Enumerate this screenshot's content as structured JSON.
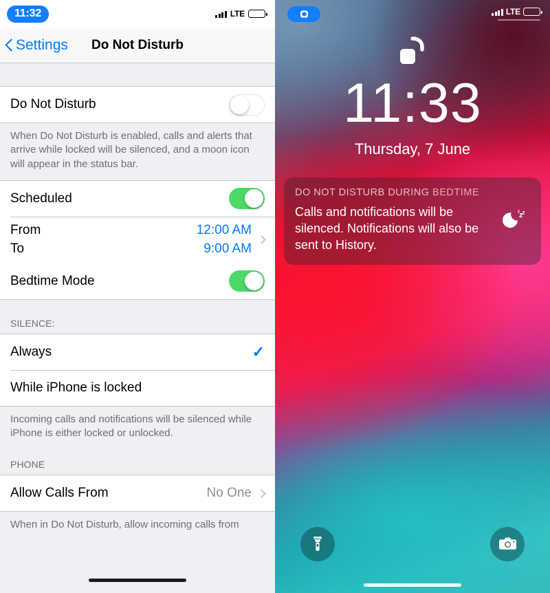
{
  "settings": {
    "status_bar": {
      "time": "11:32",
      "carrier": "LTE"
    },
    "nav": {
      "back_label": "Settings",
      "title": "Do Not Disturb"
    },
    "rows": {
      "dnd_label": "Do Not Disturb",
      "dnd_state": "off",
      "dnd_footer": "When Do Not Disturb is enabled, calls and alerts that arrive while locked will be silenced, and a moon icon will appear in the status bar.",
      "scheduled_label": "Scheduled",
      "scheduled_state": "on",
      "from_label": "From",
      "from_value": "12:00 AM",
      "to_label": "To",
      "to_value": "9:00 AM",
      "bedtime_label": "Bedtime Mode",
      "bedtime_state": "on"
    },
    "silence": {
      "header": "SILENCE:",
      "option_always": "Always",
      "option_locked": "While iPhone is locked",
      "selected": "Always",
      "footer": "Incoming calls and notifications will be silenced while iPhone is either locked or unlocked."
    },
    "phone": {
      "header": "PHONE",
      "allow_calls_label": "Allow Calls From",
      "allow_calls_value": "No One",
      "footer": "When in Do Not Disturb, allow incoming calls from"
    },
    "colors": {
      "accent": "#007aff",
      "toggle_on": "#4cd964",
      "group_bg": "#efeff4"
    }
  },
  "lockscreen": {
    "status_bar": {
      "carrier": "LTE",
      "indicator_icon": "screen-mirroring-icon"
    },
    "lock_icon": "unlocked-padlock-icon",
    "time": "11:33",
    "date": "Thursday, 7 June",
    "notification": {
      "header_prefix": "DO NOT DISTURB DURING ",
      "header_highlight": "BEDTIME",
      "body": "Calls and notifications will be silenced. Notifications will also be sent to History.",
      "icon": "moon-zzz-icon"
    },
    "quick_actions": {
      "left_icon": "flashlight-icon",
      "right_icon": "camera-icon"
    }
  }
}
